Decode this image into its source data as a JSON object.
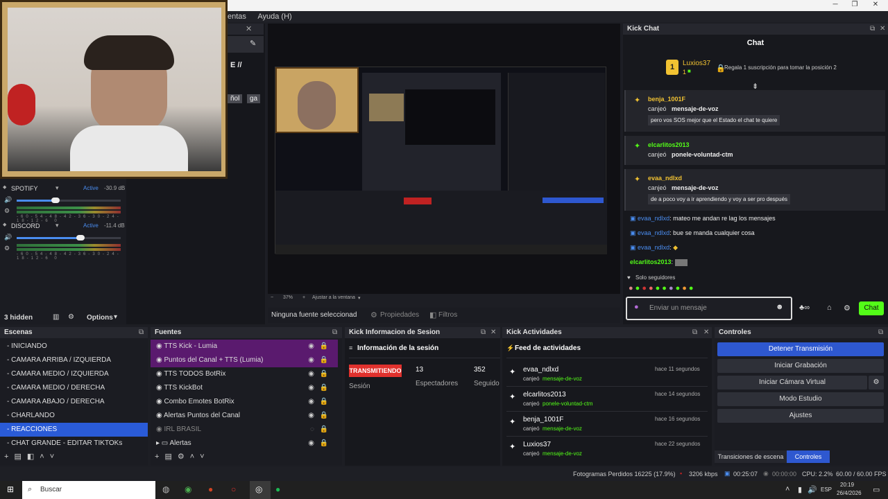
{
  "menubar": {
    "items": [
      "entas",
      "Ayuda (H)"
    ]
  },
  "mixer": {
    "tracks": [
      {
        "name": "SPOTIFY",
        "status": "Active",
        "db": "-30.9 dB",
        "volume": 0.42
      },
      {
        "name": "DISCORD",
        "status": "Active",
        "db": "-11.4 dB",
        "volume": 0.62
      }
    ],
    "scale": [
      "-60",
      "-54",
      "-48",
      "-42",
      "-36",
      "-30",
      "-24",
      "-18",
      "-12",
      "-6",
      "0"
    ],
    "hidden_count": "3 hidden",
    "options_label": "Options"
  },
  "partial_dock": {
    "text1": "E //",
    "tag1": "ñol",
    "tag2": "ga"
  },
  "preview": {
    "zoom": "37%",
    "fit_label": "Ajustar a la ventana",
    "no_source": "Ninguna fuente seleccionad",
    "properties": "Propiedades",
    "filters": "Filtros"
  },
  "kick_chat": {
    "dock_title": "Kick Chat",
    "header": "Chat",
    "top_user": {
      "name": "Luxios37",
      "count": "1",
      "rank": "1"
    },
    "gift_prompt": "Regala 1 suscripción para tomar la posición 2",
    "redeems": [
      {
        "user": "benja_1001F",
        "action": "canjeó",
        "reward": "mensaje-de-voz",
        "message": "pero vos SOS mejor que el Estado el chat te quiere",
        "color": "#f1c232"
      },
      {
        "user": "elcarlitos2013",
        "action": "canjeó",
        "reward": "ponele-voluntad-ctm",
        "message": "",
        "color": "#53fc18"
      },
      {
        "user": "evaa_ndlxd",
        "action": "canjeó",
        "reward": "mensaje-de-voz",
        "message": "de a poco voy a ir aprendiendo y voy a ser pro después",
        "color": "#f1c232"
      }
    ],
    "messages": [
      {
        "user": "evaa_ndlxd",
        "text": ": mateo me andan re lag los mensajes"
      },
      {
        "user": "evaa_ndlxd",
        "text": ": bue se manda cualquier cosa"
      },
      {
        "user": "evaa_ndlxd",
        "text": ":"
      },
      {
        "user": "elcarlitos2013",
        "text": ":"
      }
    ],
    "followers_only": "Solo seguidores",
    "input_placeholder": "Enviar un mensaje",
    "send_label": "Chat"
  },
  "scenes": {
    "title": "Escenas",
    "items": [
      "- INICIANDO",
      "- CAMARA ARRIBA / IZQUIERDA",
      "- CAMARA MEDIO / IZQUIERDA",
      "- CAMARA MEDIO / DERECHA",
      "- CAMARA ABAJO / DERECHA",
      "- CHARLANDO",
      "- REACCIONES",
      "- CHAT GRANDE - EDITAR TIKTOKs"
    ],
    "selected_index": 6
  },
  "sources": {
    "title": "Fuentes",
    "items": [
      "TTS Kick - Lumia",
      "Puntos del Canal + TTS (Lumia)",
      "TTS TODOS BotRix",
      "TTS KickBot",
      "Combo Emotes BotRix",
      "Alertas Puntos del Canal",
      "IRL BRASIL",
      "Alertas"
    ]
  },
  "session": {
    "dock_title": "Kick Informacion de Sesion",
    "title": "Información de la sesión",
    "status": "TRANSMITIENDO",
    "status_label": "Sesión",
    "viewers": "13",
    "viewers_label": "Espectadores",
    "followers": "352",
    "followers_label": "Seguido"
  },
  "activities": {
    "dock_title": "Kick Actividades",
    "title": "Feed de actividades",
    "items": [
      {
        "user": "evaa_ndlxd",
        "action": "canjeó",
        "reward": "mensaje-de-voz",
        "time": "hace 11 segundos"
      },
      {
        "user": "elcarlitos2013",
        "action": "canjeó",
        "reward": "ponele-voluntad-ctm",
        "time": "hace 14 segundos"
      },
      {
        "user": "benja_1001F",
        "action": "canjeó",
        "reward": "mensaje-de-voz",
        "time": "hace 16 segundos"
      },
      {
        "user": "Luxios37",
        "action": "canjeó",
        "reward": "mensaje-de-voz",
        "time": "hace 22 segundos"
      }
    ]
  },
  "controls": {
    "title": "Controles",
    "stop_stream": "Detener Transmisión",
    "start_record": "Iniciar Grabación",
    "virtual_cam": "Iniciar Cámara Virtual",
    "studio_mode": "Modo Estudio",
    "settings": "Ajustes",
    "tab_transitions": "Transiciones de escena",
    "tab_controls": "Controles"
  },
  "status": {
    "dropped": "Fotogramas Perdidos 16225 (17.9%)",
    "bitrate": "3206 kbps",
    "stream_time": "00:25:07",
    "record_time": "00:00:00",
    "cpu": "CPU: 2.2%",
    "fps": "60.00 / 60.00 FPS"
  },
  "taskbar": {
    "search": "Buscar",
    "lang": "ESP",
    "time": "20:19",
    "date": "26/4/2026"
  },
  "colors": {
    "accent": "#2a5bd7",
    "kick_green": "#53fc18",
    "live_red": "#e0312d"
  }
}
